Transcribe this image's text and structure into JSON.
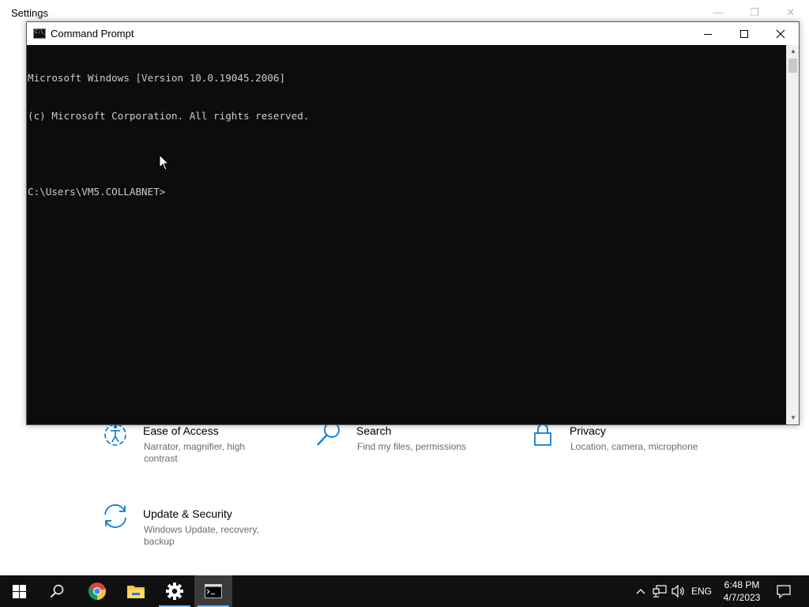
{
  "settings": {
    "title": "Settings",
    "tiles": [
      {
        "title": "Ease of Access",
        "desc": [
          "Narrator, magnifier, high",
          "contrast"
        ],
        "icon": "ease-of-access-icon"
      },
      {
        "title": "Search",
        "desc": [
          "Find my files, permissions"
        ],
        "icon": "search-icon"
      },
      {
        "title": "Privacy",
        "desc": [
          "Location, camera, microphone"
        ],
        "icon": "lock-icon"
      },
      {
        "title": "Update & Security",
        "desc": [
          "Windows Update, recovery,",
          "backup"
        ],
        "icon": "sync-icon"
      }
    ]
  },
  "cmd": {
    "title": "Command Prompt",
    "lines": [
      "Microsoft Windows [Version 10.0.19045.2006]",
      "(c) Microsoft Corporation. All rights reserved.",
      "",
      "C:\\Users\\VM5.COLLABNET>"
    ]
  },
  "taskbar": {
    "items": [
      "start-button",
      "search-button",
      "chrome-button",
      "file-explorer-button",
      "settings-button",
      "command-prompt-button"
    ],
    "active_item": "command-prompt-button",
    "language": "ENG",
    "time": "6:48 PM",
    "date": "4/7/2023"
  },
  "colors": {
    "accent": "#0078d7",
    "console_bg": "#0c0c0c",
    "console_fg": "#cccccc",
    "taskbar_bg": "#101010"
  }
}
